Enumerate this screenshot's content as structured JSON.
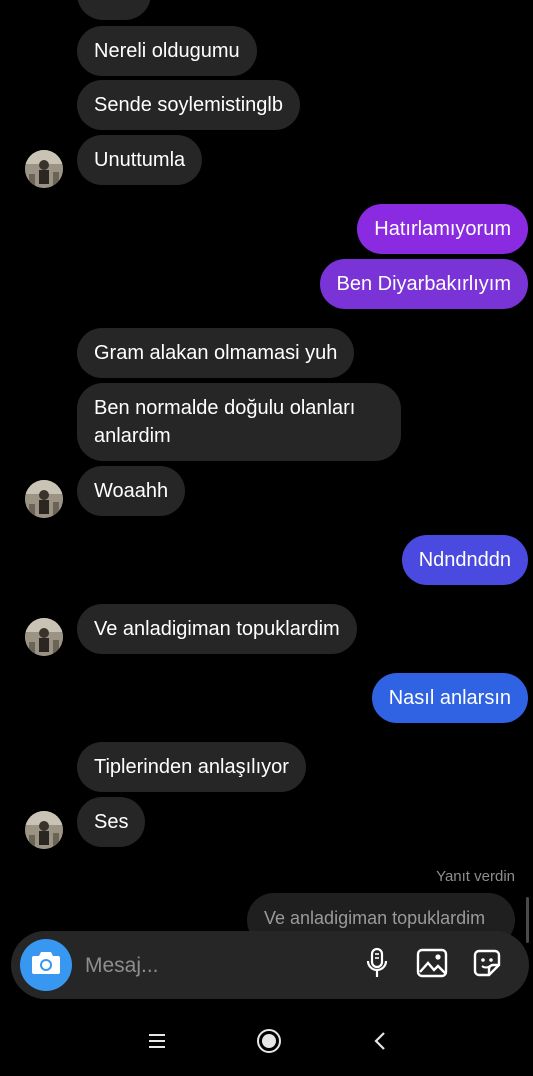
{
  "colors": {
    "incoming_bubble": "#262626",
    "outgoing_purple": "#8a2be2",
    "outgoing_blue": "#3b5bdb",
    "accent": "#3897f0"
  },
  "messages": [
    {
      "side": "in",
      "text": "Nereli oldugumu"
    },
    {
      "side": "in",
      "text": "Sende soylemistinglb"
    },
    {
      "side": "in",
      "text": "Unuttumla"
    },
    {
      "side": "out",
      "text": "Hatırlamıyorum"
    },
    {
      "side": "out",
      "text": "Ben Diyarbakırlıyım"
    },
    {
      "side": "in",
      "text": "Gram alakan olmamasi yuh"
    },
    {
      "side": "in",
      "text": "Ben normalde doğulu olanları anlardim"
    },
    {
      "side": "in",
      "text": "Woaahh"
    },
    {
      "side": "out",
      "text": "Ndndnddn"
    },
    {
      "side": "in",
      "text": "Ve anladigiman topuklardim"
    },
    {
      "side": "out",
      "text": "Nasıl anlarsın"
    },
    {
      "side": "in",
      "text": "Tiplerinden anlaşılıyor"
    },
    {
      "side": "in",
      "text": "Ses"
    }
  ],
  "reply": {
    "meta": "Yanıt verdin",
    "preview": "Ve anladigiman topuklardim"
  },
  "composer": {
    "placeholder": "Mesaj..."
  },
  "icons": {
    "camera": "camera-icon",
    "mic": "microphone-icon",
    "gallery": "gallery-icon",
    "sticker": "sticker-icon",
    "nav_menu": "menu-icon",
    "nav_home": "home-icon",
    "nav_back": "back-icon"
  }
}
